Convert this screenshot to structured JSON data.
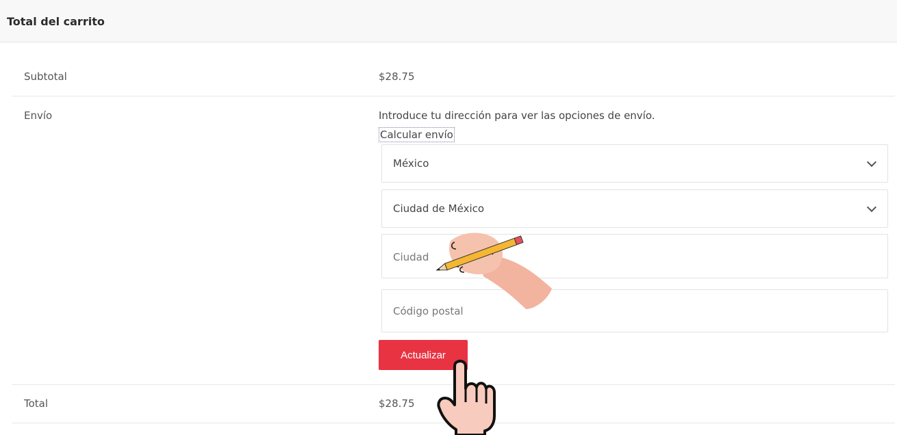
{
  "cart_totals": {
    "title": "Total del carrito",
    "subtotal_label": "Subtotal",
    "subtotal_value": "$28.75",
    "shipping_label": "Envío",
    "shipping_note": "Introduce tu dirección para ver las opciones de envío.",
    "calculate_shipping_link": "Calcular envío",
    "total_label": "Total",
    "total_value": "$28.75"
  },
  "shipping_form": {
    "country_value": "México",
    "state_value": "Ciudad de México",
    "city_placeholder": "Ciudad",
    "postcode_placeholder": "Código postal",
    "update_button_label": "Actualizar"
  },
  "colors": {
    "accent": "#e83343",
    "header_bg": "#f8f8f8"
  },
  "icons": {
    "pencil_hand": "pencil-writing-hand-icon",
    "pointer_hand": "pointing-hand-cursor-icon",
    "chevron": "chevron-down-icon"
  }
}
